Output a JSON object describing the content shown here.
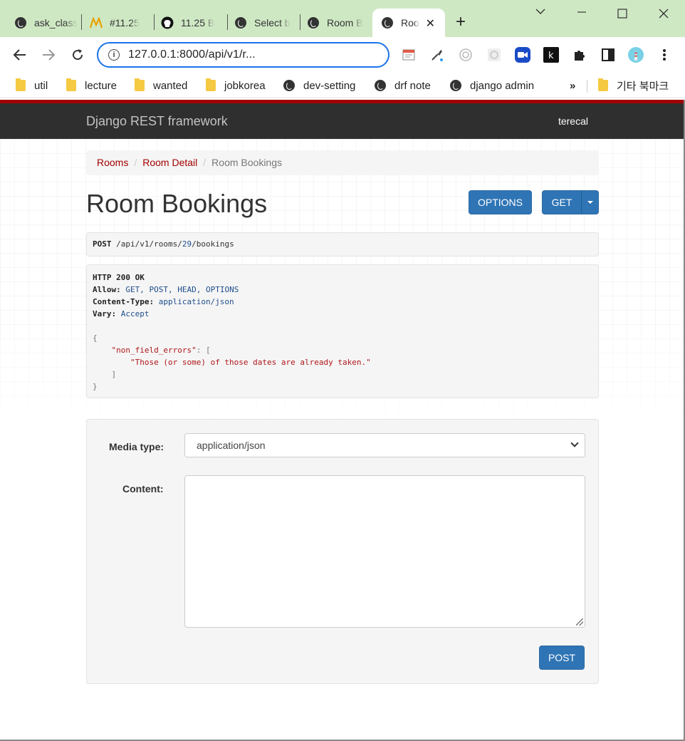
{
  "browser": {
    "tabs": [
      {
        "title": "ask_class",
        "icon": "globe-icon"
      },
      {
        "title": "#11.25",
        "icon": "brand-m-icon"
      },
      {
        "title": "11.25 B",
        "icon": "github-icon"
      },
      {
        "title": "Select b",
        "icon": "globe-icon"
      },
      {
        "title": "Room B",
        "icon": "globe-icon"
      },
      {
        "title": "Roo",
        "icon": "globe-icon",
        "active": true
      }
    ],
    "url": "127.0.0.1:8000/api/v1/r...",
    "bookmarks": [
      {
        "label": "util",
        "icon": "folder-icon"
      },
      {
        "label": "lecture",
        "icon": "folder-icon"
      },
      {
        "label": "wanted",
        "icon": "folder-icon"
      },
      {
        "label": "jobkorea",
        "icon": "folder-icon"
      },
      {
        "label": "dev-setting",
        "icon": "globe-icon"
      },
      {
        "label": "drf note",
        "icon": "globe-icon"
      },
      {
        "label": "django admin",
        "icon": "globe-icon"
      }
    ],
    "bookmarks_more": "»",
    "other_bookmarks": "기타 북마크"
  },
  "navbar": {
    "brand": "Django REST framework",
    "user": "terecal"
  },
  "breadcrumb": {
    "items": [
      "Rooms",
      "Room Detail"
    ],
    "current": "Room Bookings",
    "separator": "/"
  },
  "page": {
    "title": "Room Bookings",
    "options_label": "OPTIONS",
    "get_label": "GET"
  },
  "request": {
    "method": "POST",
    "path_parts": [
      "/api/v1/rooms/",
      "29",
      "/bookings"
    ]
  },
  "response": {
    "status": "HTTP 200 OK",
    "allow_label": "Allow:",
    "allow_value": "GET, POST, HEAD, OPTIONS",
    "content_type_label": "Content-Type:",
    "content_type_value": "application/json",
    "vary_label": "Vary:",
    "vary_value": "Accept",
    "open_brace": "{",
    "key": "\"non_field_errors\"",
    "colon_bracket": ": [",
    "message": "\"Those (or some) of those dates are already taken.\"",
    "close_bracket": "]",
    "close_brace": "}"
  },
  "form": {
    "media_type_label": "Media type:",
    "media_type_value": "application/json",
    "content_label": "Content:",
    "content_value": "",
    "post_label": "POST"
  },
  "colors": {
    "accent_red": "#a30000",
    "button_blue": "#2f75b5",
    "navbar": "#2f2f2f",
    "tabstrip": "#cfe8c4"
  }
}
